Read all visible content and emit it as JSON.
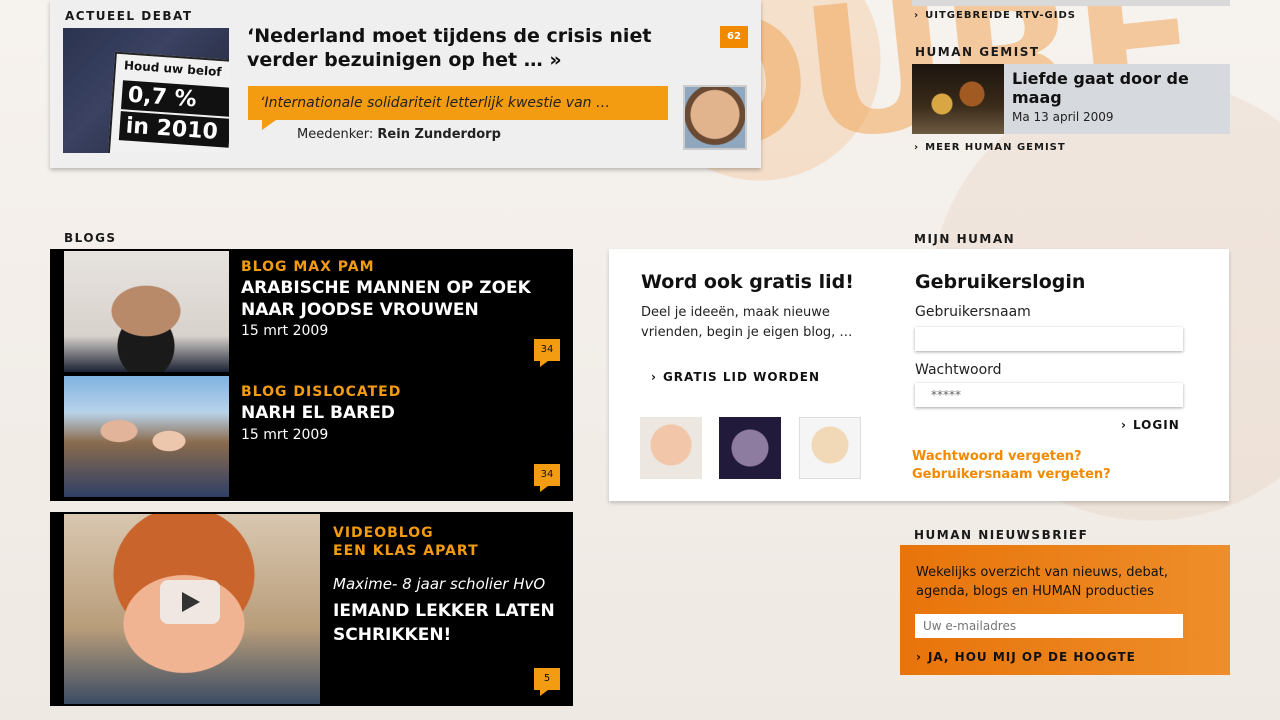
{
  "debat": {
    "section_label": "ACTUEEL DEBAT",
    "sign_line1": "Houd uw belof",
    "sign_line2": "0,7 %",
    "sign_line3": "in 2010",
    "headline": "‘Nederland moet tijdens de crisis niet verder bezuinigen op het … »",
    "comment_count": "62",
    "quote": "‘Internationale solidariteit letterlijk kwestie van …",
    "meedenker_label": "Meedenker:",
    "meedenker_name": "Rein Zunderdorp"
  },
  "right_top": {
    "rtv_link": "UITGEBREIDE RTV-GIDS",
    "human_gemist_label": "HUMAN GEMIST",
    "gemist_title": "Liefde gaat door de maag",
    "gemist_date": "Ma 13 april 2009",
    "meer_link": "MEER HUMAN GEMIST"
  },
  "blogs": {
    "section_label": "BLOGS",
    "items": [
      {
        "tag": "BLOG MAX PAM",
        "title": "ARABISCHE MANNEN OP ZOEK NAAR JOODSE VROUWEN",
        "date": "15 mrt 2009",
        "count": "34"
      },
      {
        "tag": "BLOG DISLOCATED",
        "title": "NARH EL BARED",
        "date": "15 mrt 2009",
        "count": "34"
      }
    ],
    "video": {
      "tag_line1": "VIDEOBLOG",
      "tag_line2": "EEN KLAS APART",
      "subtitle": "Maxime- 8 jaar scholier HvO",
      "title": "IEMAND LEKKER LATEN SCHRIKKEN!",
      "count": "5"
    }
  },
  "mijn_human": {
    "section_label": "MIJN HUMAN",
    "join_title": "Word ook gratis lid!",
    "join_text": "Deel je ideeën, maak nieuwe vrienden, begin je eigen blog, …",
    "join_link": "GRATIS LID WORDEN",
    "login_title": "Gebruikerslogin",
    "username_label": "Gebruikersnaam",
    "password_label": "Wachtwoord",
    "password_value": "*****",
    "login_button": "LOGIN",
    "forgot_password": "Wachtwoord vergeten?",
    "forgot_username": "Gebruikersnaam vergeten?"
  },
  "nieuwsbrief": {
    "section_label": "HUMAN NIEUWSBRIEF",
    "text": "Wekelijks overzicht van nieuws, debat, agenda, blogs en HUMAN producties",
    "placeholder": "Uw e-mailadres",
    "submit": "JA, HOU MIJ OP DE HOOGTE"
  },
  "icons": {
    "chevron": "›",
    "play": "play-icon"
  },
  "colors": {
    "accent": "#f39c12",
    "accent_dark": "#e8740a",
    "link_orange": "#f18a00"
  }
}
